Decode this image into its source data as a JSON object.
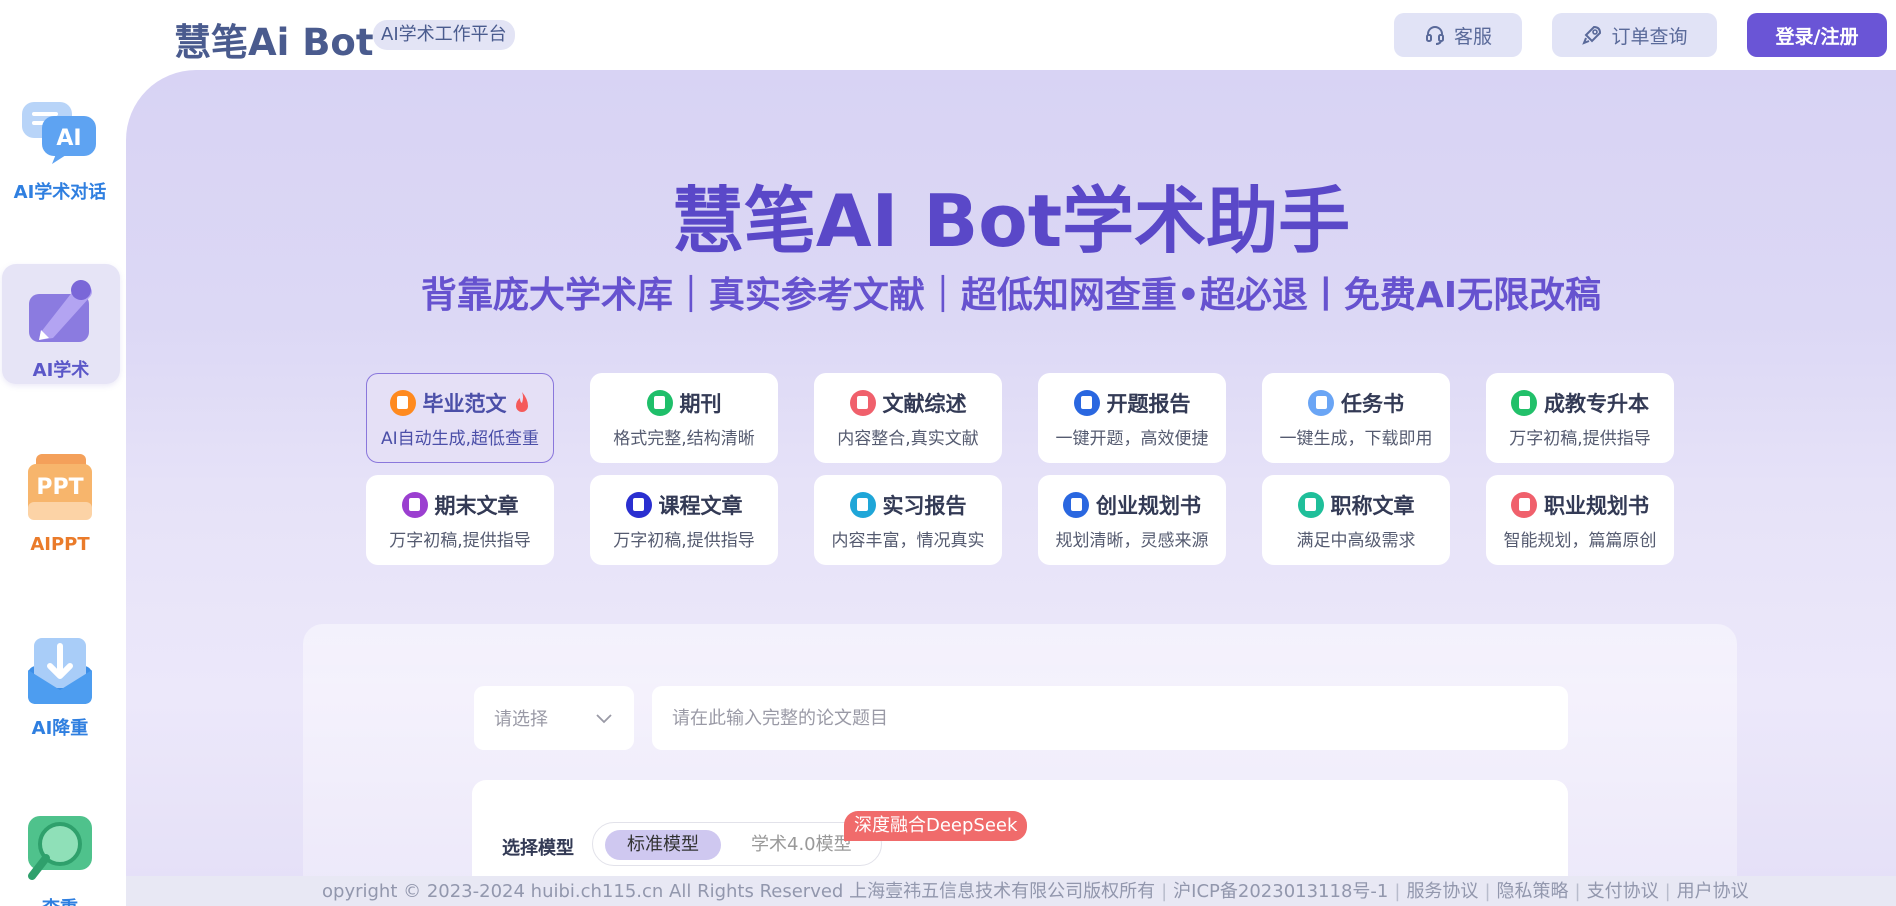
{
  "header": {
    "brand": "慧笔Ai Bot",
    "tag": "AI学术工作平台",
    "service_label": "客服",
    "order_label": "订单查询",
    "login_label": "登录/注册"
  },
  "sidebar": {
    "items": [
      {
        "label": "AI学术对话",
        "icon": "chat-ai-icon",
        "color": "#2f7fe0"
      },
      {
        "label": "AI学术",
        "icon": "pen-icon",
        "color": "#5b57c8"
      },
      {
        "label": "AIPPT",
        "icon": "ppt-icon",
        "color": "#ea7b2a"
      },
      {
        "label": "AI降重",
        "icon": "download-icon",
        "color": "#2f7fe0"
      },
      {
        "label": "查重",
        "icon": "search-icon",
        "color": "#2f7fe0"
      }
    ]
  },
  "hero": {
    "title": "慧笔AI Bot学术助手",
    "subtitle": "背靠庞大学术库｜真实参考文献｜超低知网查重•超必退丨免费AI无限改稿"
  },
  "cards": [
    {
      "title": "毕业范文",
      "desc": "AI自动生成,超低查重",
      "color": "#ff8a1f"
    },
    {
      "title": "期刊",
      "desc": "格式完整,结构清晰",
      "color": "#1fbf6a"
    },
    {
      "title": "文献综述",
      "desc": "内容整合,真实文献",
      "color": "#f0606c"
    },
    {
      "title": "开题报告",
      "desc": "一键开题，高效便捷",
      "color": "#2a67e0"
    },
    {
      "title": "任务书",
      "desc": "一键生成，下载即用",
      "color": "#6aa5f5"
    },
    {
      "title": "成教专升本",
      "desc": "万字初稿,提供指导",
      "color": "#22c06a"
    },
    {
      "title": "期末文章",
      "desc": "万字初稿,提供指导",
      "color": "#9b3fd0"
    },
    {
      "title": "课程文章",
      "desc": "万字初稿,提供指导",
      "color": "#2a2fd0"
    },
    {
      "title": "实习报告",
      "desc": "内容丰富，情况真实",
      "color": "#1fa6d8"
    },
    {
      "title": "创业规划书",
      "desc": "规划清晰，灵感来源",
      "color": "#2a67e0"
    },
    {
      "title": "职称文章",
      "desc": "满足中高级需求",
      "color": "#1fbf9a"
    },
    {
      "title": "职业规划书",
      "desc": "智能规划，篇篇原创",
      "color": "#f0606c"
    }
  ],
  "form": {
    "select_placeholder": "请选择",
    "title_placeholder": "请在此输入完整的论文题目",
    "model_label": "选择模型",
    "model_standard": "标准模型",
    "model_academic": "学术4.0模型",
    "badge": "深度融合DeepSeek"
  },
  "footer": {
    "copyright": "opyright © 2023-2024 huibi.ch115.cn All Rights Reserved 上海壹祎五信息技术有限公司版权所有",
    "icp": "沪ICP备2023013118号-1",
    "service": "服务协议",
    "privacy": "隐私策略",
    "payment": "支付协议",
    "user": "用户协议"
  }
}
